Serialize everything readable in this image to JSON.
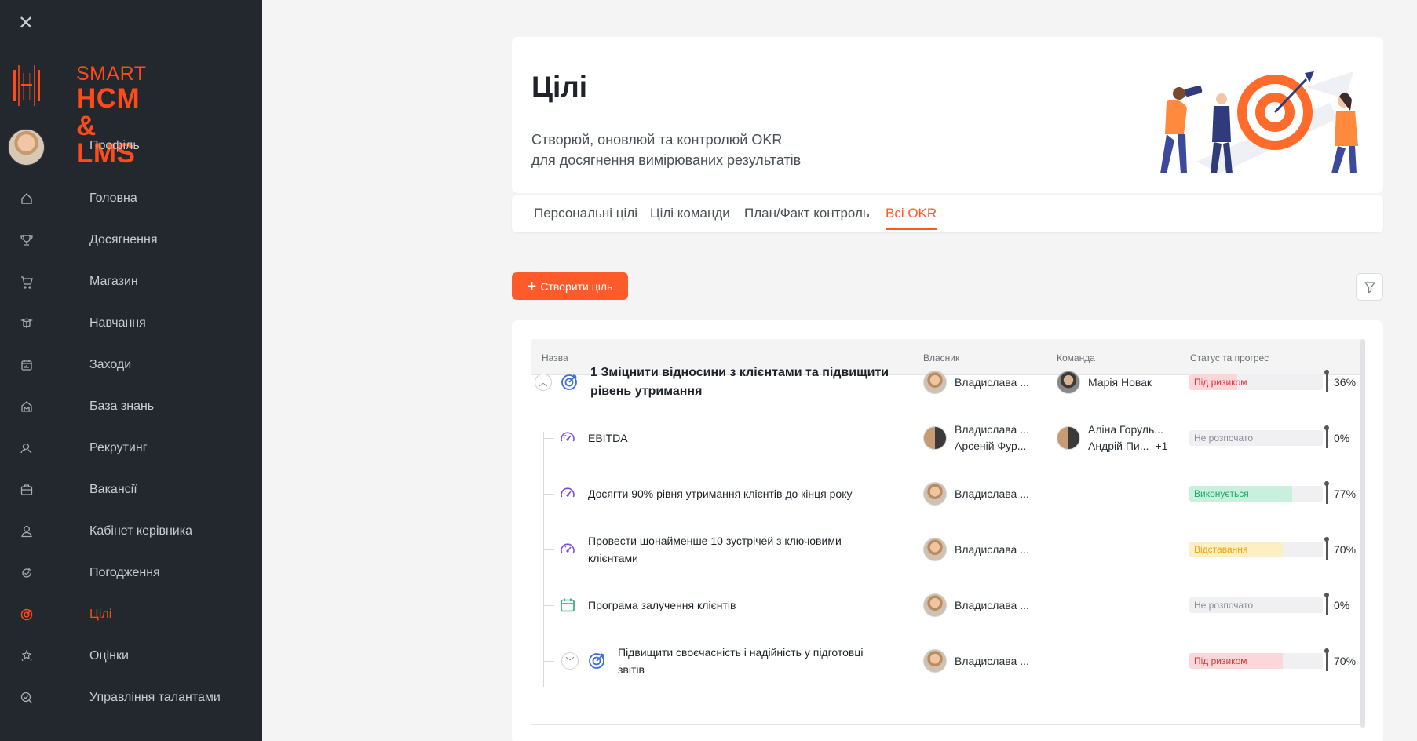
{
  "sidebar": {
    "logo_small": "SMART",
    "logo_big": "HCM & LMS",
    "profile_label": "Профіль",
    "items": [
      {
        "label": "Головна",
        "icon": "home-icon"
      },
      {
        "label": "Досягнення",
        "icon": "trophy-icon"
      },
      {
        "label": "Магазин",
        "icon": "cart-icon"
      },
      {
        "label": "Навчання",
        "icon": "book-icon"
      },
      {
        "label": "Заходи",
        "icon": "calendar-icon"
      },
      {
        "label": "База знань",
        "icon": "knowledge-icon"
      },
      {
        "label": "Рекрутинг",
        "icon": "recruit-icon"
      },
      {
        "label": "Вакансії",
        "icon": "briefcase-icon"
      },
      {
        "label": "Кабінет керівника",
        "icon": "user-icon"
      },
      {
        "label": "Погодження",
        "icon": "approval-icon"
      },
      {
        "label": "Цілі",
        "icon": "target-icon",
        "active": true
      },
      {
        "label": "Оцінки",
        "icon": "stars-icon"
      },
      {
        "label": "Управління талантами",
        "icon": "talent-icon"
      }
    ],
    "active_color": "#ff4a1c"
  },
  "header": {
    "title": "Цілі",
    "subtitle_line1": "Створюй, оновлюй та контролюй OKR",
    "subtitle_line2": "для досягнення вимірюваних результатів"
  },
  "tabs": [
    {
      "label": "Персональні цілі"
    },
    {
      "label": "Цілі команди"
    },
    {
      "label": "План/Факт контроль"
    },
    {
      "label": "Всі OKR",
      "active": true
    }
  ],
  "toolbar": {
    "create_label": "Створити ціль"
  },
  "table": {
    "columns": [
      "Назва",
      "Власник",
      "Команда",
      "Статус та прогрес"
    ],
    "rows": [
      {
        "title_line1": "1 Зміцнити відносини з клієнтами та підвищити",
        "title_line2": "рівень утримання",
        "owner": "Владислава ...",
        "team": "Марія Новак",
        "status": "Під ризиком",
        "progress": 36,
        "progress_label": "36%",
        "icon": "objective-target-icon"
      },
      {
        "title_line1": "EBITDA",
        "owner": "Владислава ...",
        "owner2": "Арсеній Фур...",
        "team": "Аліна Горуль...",
        "team2": "Андрій Пи...",
        "team_more": "+1",
        "status": "Не розпочато",
        "progress": 0,
        "progress_label": "0%",
        "icon": "speedometer-icon"
      },
      {
        "title_line1": "Досягти 90% рівня утримання клієнтів до кінця року",
        "owner": "Владислава ...",
        "status": "Виконується",
        "progress": 77,
        "progress_label": "77%",
        "icon": "speedometer-icon"
      },
      {
        "title_line1": "Провести щонайменше 10 зустрічей з ключовими",
        "title_line2": "клієнтами",
        "owner": "Владислава ...",
        "status": "Відставання",
        "progress": 70,
        "progress_label": "70%",
        "icon": "speedometer-icon"
      },
      {
        "title_line1": "Програма залучення клієнтів",
        "owner": "Владислава ...",
        "status": "Не розпочато",
        "progress": 0,
        "progress_label": "0%",
        "icon": "calendar-icon"
      },
      {
        "title_line1": "Підвищити своєчасність і надійність у підготовці",
        "title_line2": "звітів",
        "owner": "Владислава ...",
        "status": "Під ризиком",
        "progress": 70,
        "progress_label": "70%",
        "icon": "objective-target-icon"
      }
    ]
  },
  "status_colors": {
    "Під ризиком": {
      "text": "#e5303d",
      "fill": "#fbd7da"
    },
    "Не розпочато": {
      "text": "#8a8f97",
      "fill": "#ececee"
    },
    "Виконується": {
      "text": "#1ea868",
      "fill": "#c8f0dc"
    },
    "Відставання": {
      "text": "#e6a50b",
      "fill": "#fcefc4"
    }
  }
}
